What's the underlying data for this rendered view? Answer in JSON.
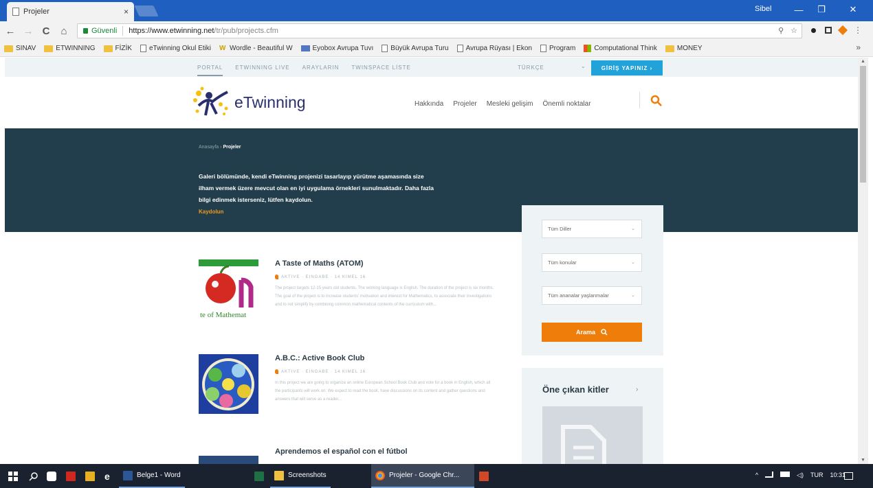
{
  "browser": {
    "tab_title": "Projeler",
    "tab_close": "×",
    "user": "Sibel",
    "win_min": "—",
    "win_max": "❐",
    "win_close": "✕",
    "back": "←",
    "forward": "→",
    "reload": "C",
    "home": "⌂",
    "secure_label": "Güvenli",
    "url_host": "https://www.etwinning.net",
    "url_path": "/tr/pub/projects.cfm",
    "zoom_icon": "⚲",
    "star_icon": "☆"
  },
  "bookmarks": [
    {
      "icon": "folder",
      "label": "SINAV"
    },
    {
      "icon": "folder",
      "label": "ETWINNING"
    },
    {
      "icon": "folder",
      "label": "FİZİK"
    },
    {
      "icon": "doc",
      "label": "eTwinning Okul Etiki"
    },
    {
      "icon": "w",
      "label": "Wordle - Beautiful W"
    },
    {
      "icon": "mail",
      "label": "Eyobox Avrupa Tuvı"
    },
    {
      "icon": "doc",
      "label": "Büyük Avrupa Turu"
    },
    {
      "icon": "doc",
      "label": "Avrupa Rüyası | Ekon"
    },
    {
      "icon": "doc",
      "label": "Program"
    },
    {
      "icon": "ms",
      "label": "Computational Think"
    },
    {
      "icon": "folder",
      "label": "MONEY"
    }
  ],
  "bookmarks_more": "»",
  "site": {
    "top_links": [
      "PORTAL",
      "ETWINNING LIVE",
      "ARAYLARIN",
      "TWINSPACE LİSTE"
    ],
    "language": "TÜRKÇE",
    "language_chevron": "⌄",
    "login_button": "GİRİŞ YAPINIZ ›",
    "logo_text": "eTwinning",
    "nav": [
      "Hakkında",
      "Projeler",
      "Mesleki gelişim",
      "Önemli noktalar"
    ],
    "breadcrumb_home": "Anasayfa",
    "breadcrumb_sep": "›",
    "breadcrumb_current": "Projeler",
    "hero_text": "Galeri bölümünde, kendi eTwinning projenizi tasarlayıp yürütme aşamasında size ilham vermek üzere mevcut olan en iyi uygulama örnekleri sunulmaktadır. Daha fazla bilgi edinmek isterseniz, lütfen kaydolun.",
    "hero_link": "Kaydolun"
  },
  "filters": {
    "languages": "Tüm Diller",
    "subjects": "Tüm konular",
    "age": "Tüm ananalar yaşlanmalar",
    "search_button": "Arama",
    "chevron": "⌄"
  },
  "kits": {
    "title": "Öne çıkan kitler",
    "arrow": "›"
  },
  "projects": [
    {
      "title": "A Taste of Maths (ATOM)",
      "meta": "AKTIVE · EINGABE · 14 KIMEL 16",
      "desc": "The project targets 12-15 years old students. The working language is English. The duration of the project is six months. The goal of the project is to increase students' motivation and interest for Mathematics, to associate their investigations and to not simplify by combining common mathematical contents of the curriculum with..."
    },
    {
      "title": "A.B.C.: Active Book Club",
      "meta": "AKTIVE · EINGABE · 14 KIMEL 16",
      "desc": "In this project we are going to organize an online European School Book Club and vote for a book in English, which all the participants will work on. We expect to read the book, have discussions on its content and gather questions and answers that will serve as a reader..."
    },
    {
      "title": "Aprendemos el español con el fútbol",
      "meta": "",
      "desc": ""
    }
  ],
  "taskbar": {
    "word_label": "Belge1 - Word",
    "screenshots_label": "Screenshots",
    "chrome_label": "Projeler - Google Chr...",
    "tray_lang": "TUR",
    "tray_time": "10:31",
    "tray_arrow": "^"
  },
  "colors": {
    "chrome_blue": "#1f5fbf",
    "hero": "#223e4c",
    "accent_orange": "#ef7d0a",
    "login_blue": "#21a3d9",
    "taskbar": "#1a2230"
  }
}
